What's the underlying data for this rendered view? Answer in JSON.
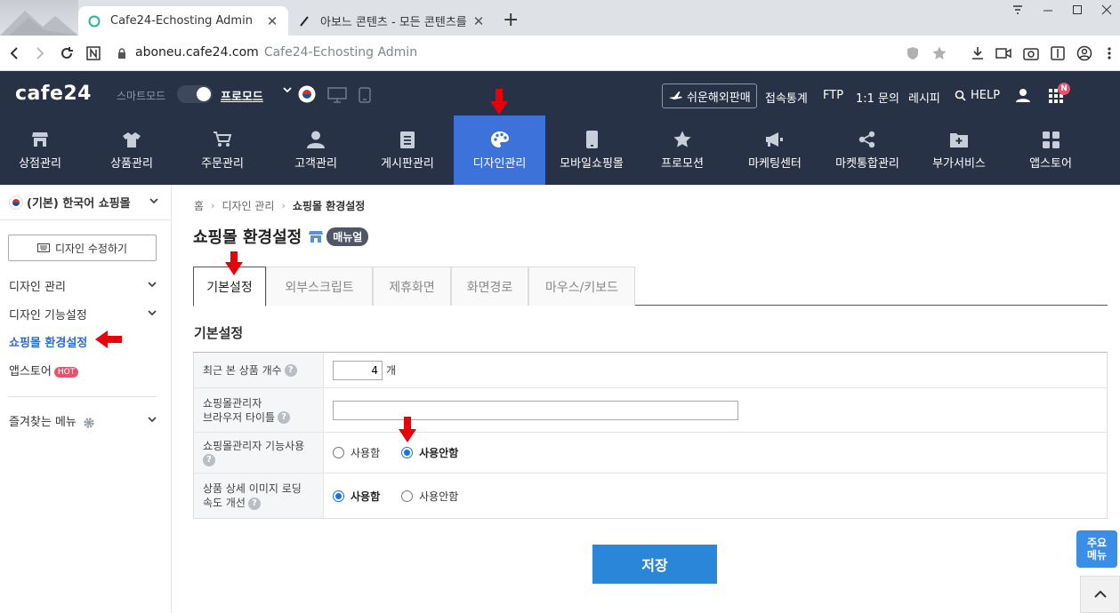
{
  "browser": {
    "tabs": [
      {
        "title": "Cafe24-Echosting Admin",
        "active": true
      },
      {
        "title": "아보느 콘텐츠 - 모든 콘텐츠를",
        "active": false
      }
    ],
    "new_tab": "+",
    "address": {
      "host": "aboneu.cafe24.com",
      "title": "Cafe24-Echosting Admin"
    }
  },
  "header": {
    "logo": "cafe24",
    "smart_mode": "스마트모드",
    "pro_mode": "프로모드",
    "overseas": "쉬운해외판매",
    "links": [
      "접속통계",
      "FTP",
      "1:1 문의",
      "레시피",
      "HELP"
    ],
    "badge": "N"
  },
  "nav": {
    "items": [
      {
        "label": "상점관리",
        "icon": "store-icon"
      },
      {
        "label": "상품관리",
        "icon": "shirt-icon"
      },
      {
        "label": "주문관리",
        "icon": "cart-icon"
      },
      {
        "label": "고객관리",
        "icon": "person-icon"
      },
      {
        "label": "게시판관리",
        "icon": "board-icon"
      },
      {
        "label": "디자인관리",
        "icon": "palette-icon",
        "active": true
      },
      {
        "label": "모바일쇼핑몰",
        "icon": "mobile-icon"
      },
      {
        "label": "프로모션",
        "icon": "star-icon"
      },
      {
        "label": "마케팅센터",
        "icon": "megaphone-icon"
      },
      {
        "label": "마켓통합관리",
        "icon": "share-icon"
      },
      {
        "label": "부가서비스",
        "icon": "folder-plus-icon"
      },
      {
        "label": "앱스토어",
        "icon": "grid-icon"
      }
    ]
  },
  "sidebar": {
    "shop": "(기본) 한국어 쇼핑몰",
    "design_edit": "디자인 수정하기",
    "items": [
      {
        "label": "디자인 관리"
      },
      {
        "label": "디자인 기능설정"
      },
      {
        "label": "쇼핑몰 환경설정"
      },
      {
        "label": "앱스토어",
        "badge": "HOT"
      },
      {
        "label": "즐겨찾는 메뉴"
      }
    ]
  },
  "breadcrumb": [
    "홈",
    "디자인 관리",
    "쇼핑몰 환경설정"
  ],
  "page": {
    "title": "쇼핑몰 환경설정",
    "manual": "매뉴얼",
    "tabs": [
      "기본설정",
      "외부스크립트",
      "제휴화면",
      "화면경로",
      "마우스/키보드"
    ],
    "section_title": "기본설정",
    "form": {
      "recent_count": {
        "label": "최근 본 상품 개수",
        "value": "4",
        "unit": "개"
      },
      "browser_title": {
        "label1": "쇼핑몰관리자",
        "label2": "브라우저 타이틀",
        "value": ""
      },
      "admin_feature": {
        "label": "쇼핑몰관리자 기능사용",
        "options": [
          "사용함",
          "사용안함"
        ],
        "selected": "사용안함"
      },
      "image_loading": {
        "label1": "상품 상세 이미지 로딩",
        "label2": "속도 개선",
        "options": [
          "사용함",
          "사용안함"
        ],
        "selected": "사용함"
      }
    },
    "save": "저장"
  },
  "quick_menu": {
    "line1": "주요",
    "line2": "메뉴"
  },
  "colors": {
    "header_bg": "#273246",
    "active_nav": "#3d72db",
    "save_button": "#2a86d9",
    "annotation_arrow": "#e8000b"
  }
}
